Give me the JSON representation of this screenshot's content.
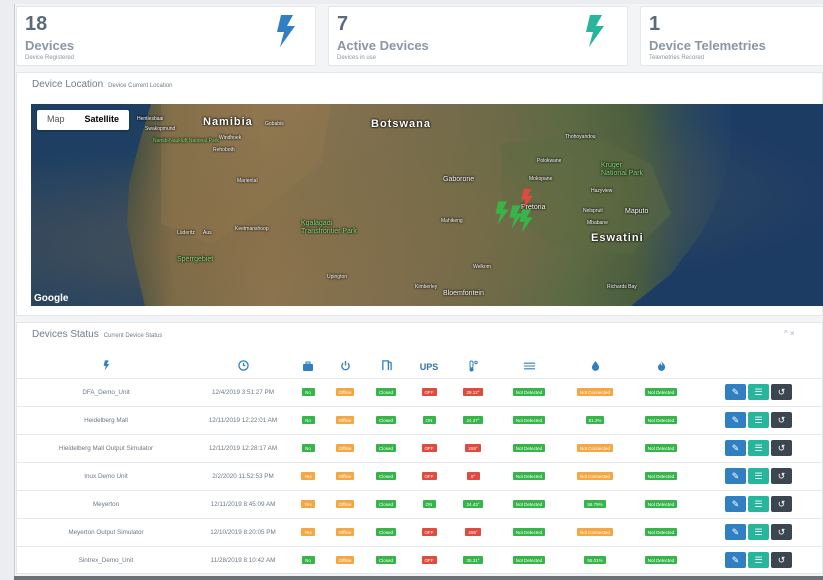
{
  "cards": [
    {
      "number": "18",
      "title": "Devices",
      "subtitle": "Device Registered",
      "icon": "bolt-icon",
      "color": "#2f7fc1"
    },
    {
      "number": "7",
      "title": "Active Devices",
      "subtitle": "Devices in use",
      "icon": "bolt-icon",
      "color": "#27b59c"
    },
    {
      "number": "1",
      "title": "Device Telemetries",
      "subtitle": "Telemetries Recored"
    }
  ],
  "location": {
    "title": "Device Location",
    "subtitle": "Device Current Location",
    "map_types": [
      "Map",
      "Satellite"
    ],
    "active_map_type": "Satellite",
    "attribution": "Google",
    "labels": {
      "namibia": "Namibia",
      "gobabis": "Gobabis",
      "botswana": "Botswana",
      "henties": "Hentiesbaai",
      "swakop": "Swakopmund",
      "naukluft": "Namib-Naukluft National Park",
      "rehoboth": "Rehoboth",
      "windhoek": "Windhoek",
      "mariental": "Mariental",
      "keetman": "Keetmanshoop",
      "luderitz": "Lüderitz",
      "aus": "Aus",
      "kgalagadi": "Kgalagadi Transfrontier Park",
      "sperrgebiet": "Sperrgebiet",
      "upington": "Upington",
      "kimberley": "Kimberley",
      "bloemfontein": "Bloemfontein",
      "welkom": "Welkom",
      "gaborone": "Gaborone",
      "mahikeng": "Mahikeng",
      "pretoria": "Pretoria",
      "mokopane": "Mokopane",
      "polokwane": "Polokwane",
      "thohoyandou": "Thohoyandou",
      "kruger": "Kruger National Park",
      "hazyview": "Hazyview",
      "nelspruit": "Nelspruit",
      "mbabane": "Mbabane",
      "maputo": "Maputo",
      "eswatini": "Eswatini",
      "richards": "Richards Bay"
    },
    "marker_colors": {
      "active": "#38b54a",
      "alert": "#e04a3f"
    }
  },
  "status": {
    "title": "Devices Status",
    "subtitle": "Current Device Status",
    "window_controls": "^ ×",
    "columns": [
      "bolt-icon",
      "clock-icon",
      "toolbox-icon",
      "power-icon",
      "door-icon",
      "UPS",
      "thermometer-icon",
      "waves-icon",
      "water-drop-icon",
      "flame-icon"
    ],
    "ups_label": "UPS",
    "rows": [
      {
        "name": "DFA_Demo_Unit",
        "time": "12/4/2019 3:51:27 PM",
        "c1": [
          "No",
          "g"
        ],
        "c2": [
          "Offline",
          "o"
        ],
        "c3": [
          "Closed",
          "g"
        ],
        "ups": [
          "OFF",
          "r"
        ],
        "temp": [
          "29.12°",
          "r"
        ],
        "c6": [
          "Not Detected",
          "g"
        ],
        "c7": [
          "Not Connected",
          "o"
        ],
        "c8": [
          "Not Detected",
          "g"
        ]
      },
      {
        "name": "Heidelberg Mall",
        "time": "12/11/2019 12:22:01 AM",
        "c1": [
          "No",
          "g"
        ],
        "c2": [
          "Offline",
          "o"
        ],
        "c3": [
          "Closed",
          "g"
        ],
        "ups": [
          "ON",
          "g"
        ],
        "temp": [
          "24.37°",
          "g"
        ],
        "c6": [
          "Not Detected",
          "g"
        ],
        "c7": [
          "51.2%",
          "g"
        ],
        "c8": [
          "Not Detected",
          "g"
        ]
      },
      {
        "name": "Hieidelberg Mall Output Simulator",
        "time": "12/11/2019 12:28:17 AM",
        "c1": [
          "No",
          "g"
        ],
        "c2": [
          "Offline",
          "o"
        ],
        "c3": [
          "Closed",
          "g"
        ],
        "ups": [
          "OFF",
          "r"
        ],
        "temp": [
          "255°",
          "r"
        ],
        "c6": [
          "Not Detected",
          "g"
        ],
        "c7": [
          "Not Connected",
          "o"
        ],
        "c8": [
          "Not Detected",
          "g"
        ]
      },
      {
        "name": "Inux Demo Unit",
        "time": "2/2/2020 11:52:53 PM",
        "c1": [
          "Yes",
          "o"
        ],
        "c2": [
          "Offline",
          "o"
        ],
        "c3": [
          "Closed",
          "g"
        ],
        "ups": [
          "OFF",
          "r"
        ],
        "temp": [
          "0°",
          "r"
        ],
        "c6": [
          "Not Detected",
          "g"
        ],
        "c7": [
          "Not Connected",
          "o"
        ],
        "c8": [
          "Not Detected",
          "g"
        ]
      },
      {
        "name": "Meyerton",
        "time": "12/11/2019 8:45:09 AM",
        "c1": [
          "Yes",
          "o"
        ],
        "c2": [
          "Offline",
          "o"
        ],
        "c3": [
          "Closed",
          "g"
        ],
        "ups": [
          "ON",
          "g"
        ],
        "temp": [
          "24.43°",
          "g"
        ],
        "c6": [
          "Not Detected",
          "g"
        ],
        "c7": [
          "59.79%",
          "g"
        ],
        "c8": [
          "Not Detected",
          "g"
        ]
      },
      {
        "name": "Meyerton Output Simulator",
        "time": "12/10/2019 8:20:05 PM",
        "c1": [
          "Yes",
          "o"
        ],
        "c2": [
          "Offline",
          "o"
        ],
        "c3": [
          "Closed",
          "g"
        ],
        "ups": [
          "OFF",
          "r"
        ],
        "temp": [
          "255°",
          "r"
        ],
        "c6": [
          "Not Detected",
          "g"
        ],
        "c7": [
          "Not Connected",
          "o"
        ],
        "c8": [
          "Not Detected",
          "g"
        ]
      },
      {
        "name": "Sintrex_Demo_Unit",
        "time": "11/28/2019 8:10:42 AM",
        "c1": [
          "No",
          "g"
        ],
        "c2": [
          "Offline",
          "o"
        ],
        "c3": [
          "Closed",
          "g"
        ],
        "ups": [
          "OFF",
          "r"
        ],
        "temp": [
          "35.31°",
          "g"
        ],
        "c6": [
          "Not Detected",
          "g"
        ],
        "c7": [
          "55.01%",
          "g"
        ],
        "c8": [
          "Not Detected",
          "g"
        ]
      }
    ],
    "actions": [
      {
        "name": "edit-icon",
        "style": "b",
        "glyph": "✎"
      },
      {
        "name": "list-icon",
        "style": "t",
        "glyph": "☰"
      },
      {
        "name": "history-icon",
        "style": "d",
        "glyph": "↺"
      }
    ]
  }
}
